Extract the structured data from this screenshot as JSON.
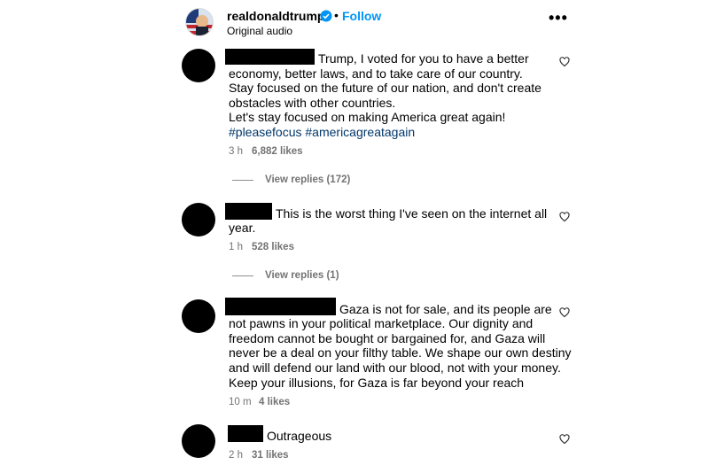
{
  "post": {
    "username": "realdonaldtrump",
    "follow_label": "Follow",
    "separator": "•",
    "audio": "Original audio",
    "more_label": "•••",
    "icons": {
      "verified": "verified-badge-icon",
      "more": "more-options-icon",
      "like": "heart-icon"
    },
    "accent_color": "#0095f6"
  },
  "comments": [
    {
      "text_lines": [
        "Trump, I voted for you to have a better",
        "economy, better laws, and to take care of our country.",
        "Stay focused on the future of our nation, and don't create",
        "obstacles with other countries.",
        "Let's stay focused on making America great again!"
      ],
      "hashtags": "#pleasefocus #americagreatagain",
      "time": "3 h",
      "likes": "6,882 likes",
      "view_replies": "View replies (172)"
    },
    {
      "text_lines": [
        "This is the worst thing I've seen on the internet all",
        "year."
      ],
      "time": "1 h",
      "likes": "528 likes",
      "view_replies": "View replies (1)"
    },
    {
      "text_lines": [
        "Gaza is not for sale, and its people are",
        "not pawns in your political marketplace. Our dignity and",
        "freedom cannot be bought or bargained for, and Gaza will",
        "never be a deal on your filthy table. We shape our own destiny",
        "and will defend our land with our blood, not with your money.",
        "Keep your illusions, for Gaza is far beyond your reach"
      ],
      "time": "10 m",
      "likes": "4 likes"
    },
    {
      "text_lines": [
        "Outrageous"
      ],
      "time": "2 h",
      "likes": "31 likes"
    }
  ]
}
